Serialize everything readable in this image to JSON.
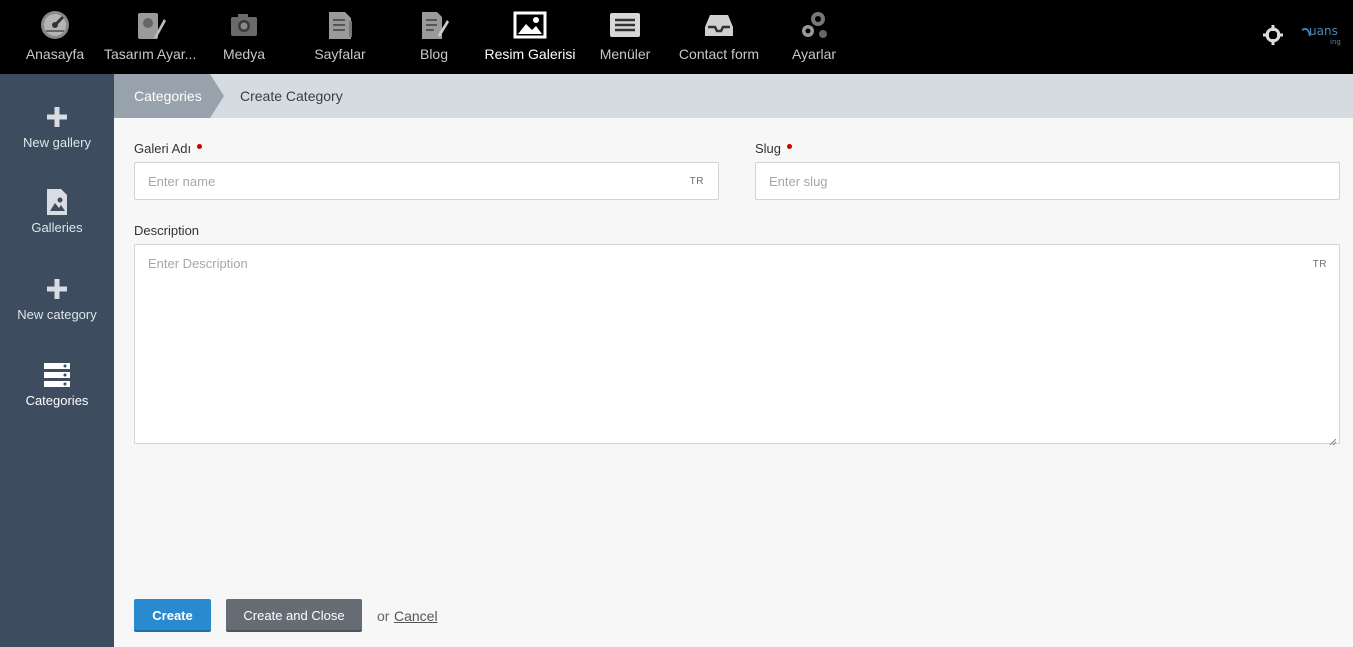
{
  "topnav": {
    "items": [
      {
        "label": "Anasayfa",
        "icon": "speedometer-icon"
      },
      {
        "label": "Tasarım Ayar...",
        "icon": "design-pencil-icon"
      },
      {
        "label": "Medya",
        "icon": "camera-icon"
      },
      {
        "label": "Sayfalar",
        "icon": "pages-icon"
      },
      {
        "label": "Blog",
        "icon": "blog-edit-icon"
      },
      {
        "label": "Resim Galerisi",
        "icon": "picture-icon",
        "active": true
      },
      {
        "label": "Menüler",
        "icon": "menu-list-icon"
      },
      {
        "label": "Contact form",
        "icon": "inbox-icon"
      },
      {
        "label": "Ayarlar",
        "icon": "gears-icon"
      }
    ],
    "right_icons": [
      "crosshair-icon",
      "brand-logo"
    ]
  },
  "sidebar": {
    "items": [
      {
        "label": "New gallery",
        "icon": "plus-icon"
      },
      {
        "label": "Galleries",
        "icon": "image-file-icon"
      },
      {
        "label": "New category",
        "icon": "plus-icon"
      },
      {
        "label": "Categories",
        "icon": "server-list-icon",
        "active": true
      }
    ]
  },
  "breadcrumb": {
    "items": [
      "Categories",
      "Create Category"
    ]
  },
  "form": {
    "name": {
      "label": "Galeri Adı",
      "placeholder": "Enter name",
      "value": "",
      "lang": "TR",
      "required": true
    },
    "slug": {
      "label": "Slug",
      "placeholder": "Enter slug",
      "value": "",
      "required": true
    },
    "description": {
      "label": "Description",
      "placeholder": "Enter Description",
      "value": "",
      "lang": "TR"
    }
  },
  "actions": {
    "create_label": "Create",
    "create_close_label": "Create and Close",
    "or_text": "or",
    "cancel_label": "Cancel"
  },
  "colors": {
    "topbar_bg": "#000000",
    "sidebar_bg": "#3d4c5e",
    "breadcrumb_bg": "#d5dbe1",
    "breadcrumb_active_bg": "#98a2ad",
    "primary_button": "#2a8ad0",
    "secondary_button": "#666c73",
    "required_marker": "#cc0000"
  }
}
